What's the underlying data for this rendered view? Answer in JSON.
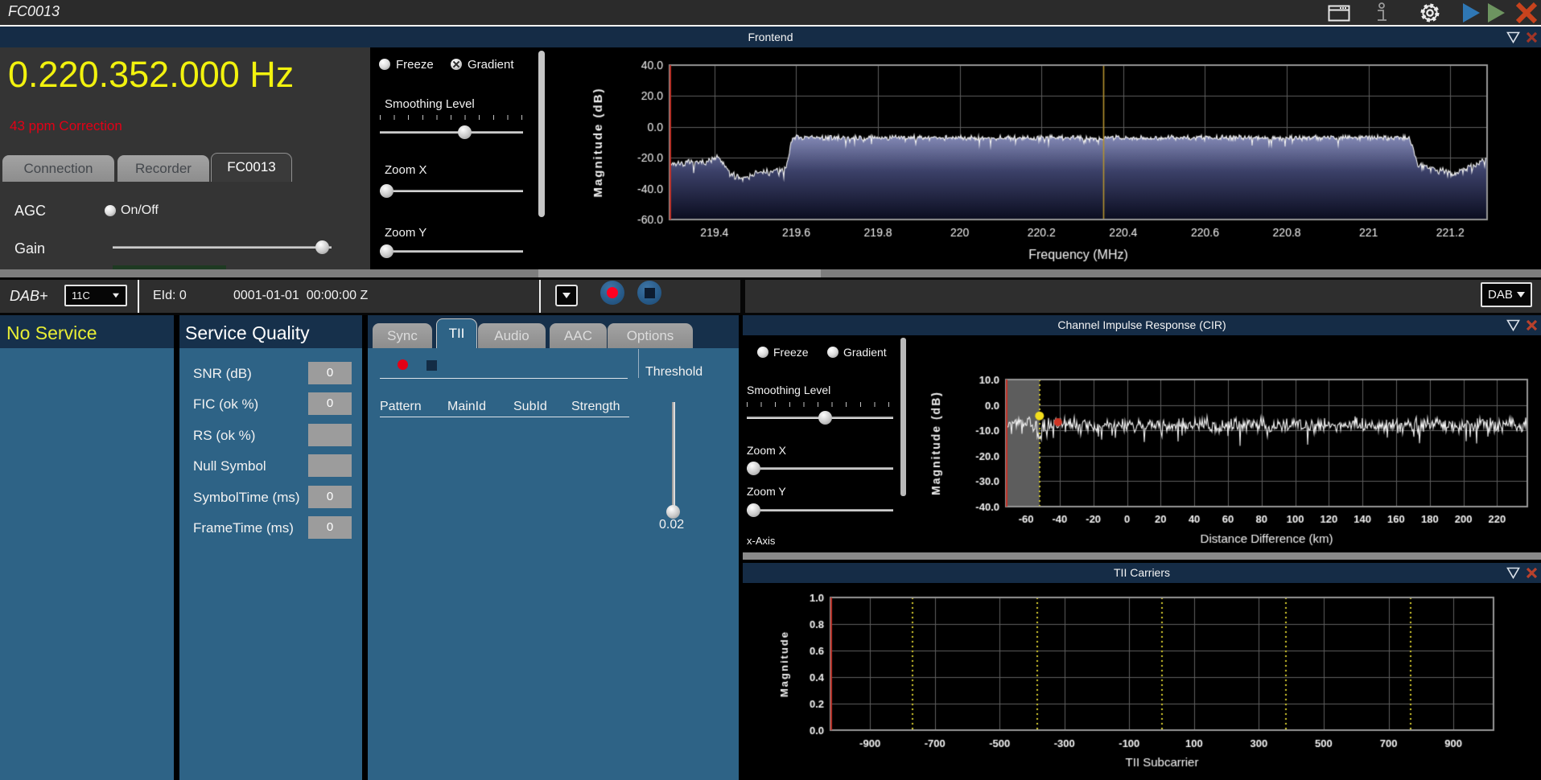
{
  "window": {
    "title": "FC0013"
  },
  "frontend": {
    "title": "Frontend",
    "frequency": "0.220.352.000 Hz",
    "correction": "43 ppm Correction",
    "tabs": [
      "Connection",
      "Recorder",
      "FC0013"
    ],
    "active_tab": "FC0013",
    "agc_label": "AGC",
    "agc_toggle": "On/Off",
    "gain_label": "Gain",
    "freeze_label": "Freeze",
    "gradient_label": "Gradient",
    "smoothing_label": "Smoothing Level",
    "zoom_x_label": "Zoom X",
    "zoom_y_label": "Zoom Y"
  },
  "dab_bar": {
    "mode": "DAB+",
    "channel": "11C",
    "ensemble_id": "EId: 0",
    "datetime": "0001-01-01  00:00:00 Z",
    "output_mode": "DAB"
  },
  "service_list": {
    "title": "No Service"
  },
  "service_quality": {
    "title": "Service Quality",
    "rows": [
      {
        "label": "SNR (dB)",
        "value": "0"
      },
      {
        "label": "FIC (ok %)",
        "value": "0"
      },
      {
        "label": "RS (ok %)",
        "value": ""
      },
      {
        "label": "Null Symbol",
        "value": ""
      },
      {
        "label": "SymbolTime (ms)",
        "value": "0"
      },
      {
        "label": "FrameTime (ms)",
        "value": "0"
      }
    ]
  },
  "detail_panel": {
    "tabs": [
      "Sync",
      "TII",
      "Audio",
      "AAC",
      "Options"
    ],
    "active_tab": "TII",
    "columns": [
      "Pattern",
      "MainId",
      "SubId",
      "Strength"
    ],
    "threshold_label": "Threshold",
    "threshold_value": "0.02"
  },
  "cir_panel": {
    "title": "Channel Impulse Response (CIR)",
    "freeze_label": "Freeze",
    "gradient_label": "Gradient",
    "smoothing_label": "Smoothing Level",
    "zoom_x_label": "Zoom X",
    "zoom_y_label": "Zoom Y",
    "x_axis_label": "x-Axis"
  },
  "tii_panel": {
    "title": "TII Carriers"
  },
  "colors": {
    "panel_blue": "#2E6386",
    "header_navy": "#16304B",
    "service_yellow": "#E9EE35",
    "alert_red": "#E30016",
    "frequency_yellow": "#F2F20E",
    "record_red": "#FF0021",
    "marker_yellow": "#C8A21E"
  },
  "chart_data": [
    {
      "id": "spectrum",
      "type": "line",
      "title": "Frontend spectrum",
      "xlabel": "Frequency (MHz)",
      "ylabel": "Magnitude (dB)",
      "xlim": [
        219.29,
        221.29
      ],
      "ylim": [
        -60,
        40
      ],
      "xticks": [
        219.4,
        219.6,
        219.8,
        220,
        220.2,
        220.4,
        220.6,
        220.8,
        221,
        221.2
      ],
      "yticks": [
        40,
        20,
        0,
        -20,
        -40,
        -60
      ],
      "marker_line_x": 220.352,
      "marker_line_color": "#b3922f",
      "envelope": [
        [
          219.29,
          -24
        ],
        [
          219.37,
          -23
        ],
        [
          219.41,
          -20
        ],
        [
          219.44,
          -31
        ],
        [
          219.47,
          -33
        ],
        [
          219.5,
          -30
        ],
        [
          219.54,
          -29
        ],
        [
          219.575,
          -27
        ],
        [
          219.59,
          -7
        ],
        [
          221.1,
          -7
        ],
        [
          221.12,
          -24
        ],
        [
          221.17,
          -28
        ],
        [
          221.22,
          -30
        ],
        [
          221.25,
          -26
        ],
        [
          221.27,
          -23
        ],
        [
          221.29,
          -19
        ]
      ],
      "noise_amp": [
        [
          219.29,
          2.6
        ],
        [
          219.57,
          2.6
        ],
        [
          219.6,
          2.0
        ],
        [
          221.09,
          2.0
        ],
        [
          221.12,
          2.6
        ],
        [
          221.29,
          2.6
        ]
      ],
      "spike_p": 0.05,
      "spike_d": 5,
      "fill": true,
      "fill_top": -3,
      "fill_stops": [
        [
          0,
          "#8d93c0"
        ],
        [
          0.45,
          "#3c4169"
        ],
        [
          1,
          "#0b0d20"
        ]
      ],
      "trace_color": "#f4f4f4",
      "seed": 7
    },
    {
      "id": "cir",
      "type": "line",
      "title": "Channel Impulse Response",
      "xlabel": "Distance Difference (km)",
      "ylabel": "Magnitude (dB)",
      "xlim": [
        -72,
        238
      ],
      "ylim": [
        -40,
        10
      ],
      "xticks": [
        -60,
        -40,
        -20,
        0,
        20,
        40,
        60,
        80,
        100,
        120,
        140,
        160,
        180,
        200,
        220
      ],
      "yticks": [
        10,
        0,
        -10,
        -20,
        -30,
        -40
      ],
      "gray_band": [
        -72,
        -52
      ],
      "dotted_line_x": -52,
      "markers": [
        {
          "x": -52,
          "y": -4.3,
          "color": "#f2dd1c",
          "r": 5.5
        },
        {
          "x": -41,
          "y": -6.8,
          "color": "#d03524",
          "r": 5
        }
      ],
      "envelope": [
        [
          -72,
          -7.5
        ],
        [
          -54,
          -7.5
        ],
        [
          -52.3,
          -14.5
        ],
        [
          -50,
          -8
        ],
        [
          238,
          -8
        ]
      ],
      "noise_amp": 3.6,
      "spike_p": 0.07,
      "spike_d": 6,
      "trace_color": "#f4f4f4",
      "seed": 3
    },
    {
      "id": "tii",
      "type": "line",
      "title": "TII Carriers",
      "xlabel": "TII Subcarrier",
      "ylabel": "Magnitude",
      "xlim": [
        -1022,
        1024
      ],
      "ylim": [
        0,
        1
      ],
      "xticks": [
        -900,
        -700,
        -500,
        -300,
        -100,
        100,
        300,
        500,
        700,
        900
      ],
      "yticks": [
        1,
        0.8,
        0.6,
        0.4,
        0.2,
        0
      ],
      "yellow_dotted_x": [
        -768,
        -384,
        0,
        384,
        768
      ],
      "series": []
    }
  ]
}
